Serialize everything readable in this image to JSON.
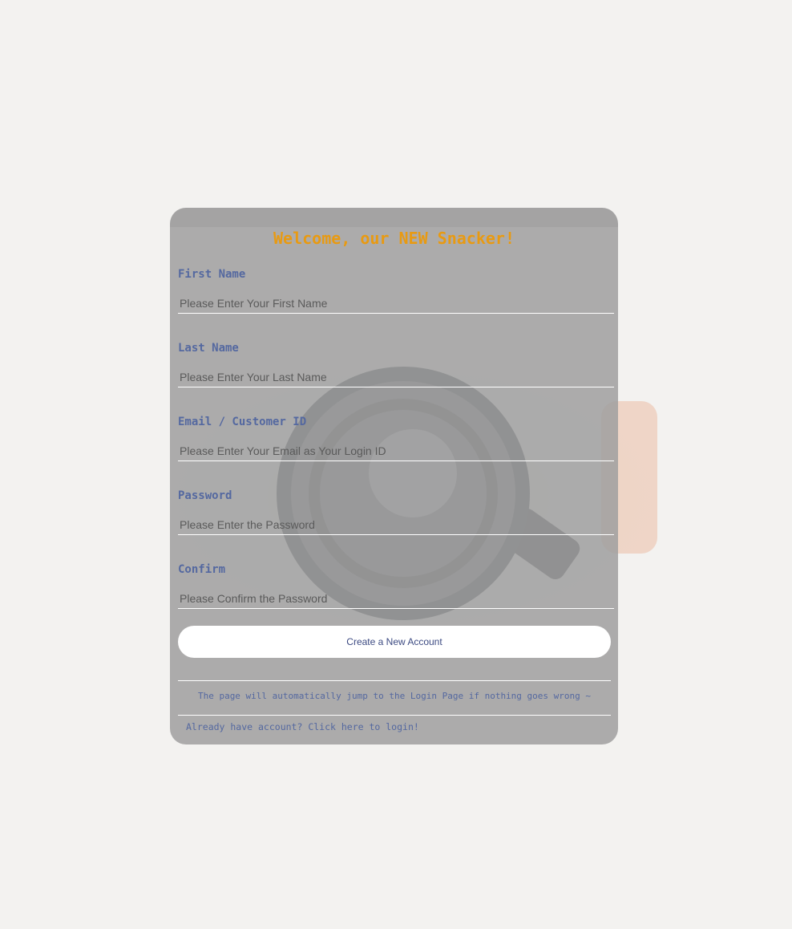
{
  "form": {
    "title": "Welcome, our NEW Snacker!",
    "fields": [
      {
        "label": "First Name",
        "placeholder": "Please Enter Your First Name",
        "value": ""
      },
      {
        "label": "Last Name",
        "placeholder": "Please Enter Your Last Name",
        "value": ""
      },
      {
        "label": "Email / Customer ID",
        "placeholder": "Please Enter Your Email as Your Login ID",
        "value": ""
      },
      {
        "label": "Password",
        "placeholder": "Please Enter the Password",
        "value": ""
      },
      {
        "label": "Confirm",
        "placeholder": "Please Confirm the Password",
        "value": ""
      }
    ],
    "submit_label": "Create a New Account",
    "notice": "The page will automatically jump to the Login Page if nothing goes wrong ~",
    "login_link": "Already have account? Click here to login!"
  },
  "colors": {
    "page_background": "#f3f2f0",
    "title": "#e89a12",
    "label": "#5468a0",
    "button_text": "#3c4a82"
  }
}
